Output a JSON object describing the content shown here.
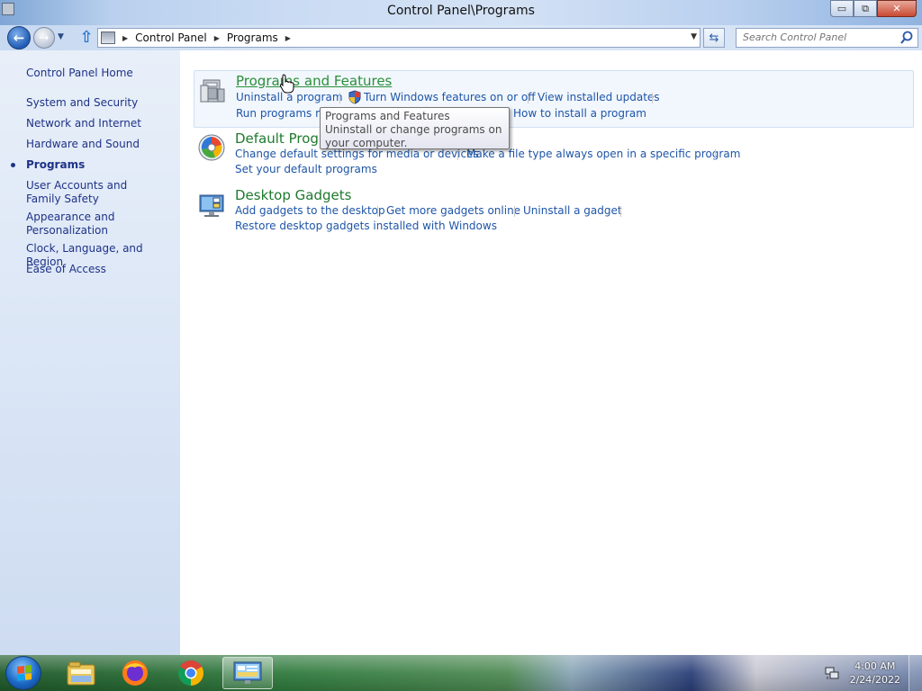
{
  "window": {
    "title": "Control Panel\\Programs",
    "buttons": {
      "minimize": "▭",
      "restore": "⧉",
      "close": "✕"
    }
  },
  "nav": {
    "back_icon": "back-arrow-icon",
    "forward_icon": "forward-arrow-icon",
    "breadcrumb": [
      "Control Panel",
      "Programs"
    ],
    "search_placeholder": "Search Control Panel"
  },
  "sidebar": {
    "items": [
      {
        "label": "Control Panel Home",
        "current": false
      },
      {
        "label": "System and Security",
        "current": false
      },
      {
        "label": "Network and Internet",
        "current": false
      },
      {
        "label": "Hardware and Sound",
        "current": false
      },
      {
        "label": "Programs",
        "current": true
      },
      {
        "label": "User Accounts and Family Safety",
        "current": false
      },
      {
        "label": "Appearance and Personalization",
        "current": false
      },
      {
        "label": "Clock, Language, and Region",
        "current": false
      },
      {
        "label": "Ease of Access",
        "current": false
      }
    ]
  },
  "categories": [
    {
      "title": "Programs and Features",
      "icon": "programs-features-icon",
      "hovered": true,
      "links": [
        "Uninstall a program",
        "Turn Windows features on or off",
        "View installed updates",
        "Run programs made for previous versions of Windows",
        "How to install a program"
      ]
    },
    {
      "title": "Default Programs",
      "icon": "default-programs-icon",
      "hovered": false,
      "links": [
        "Change default settings for media or devices",
        "Make a file type always open in a specific program",
        "Set your default programs"
      ]
    },
    {
      "title": "Desktop Gadgets",
      "icon": "desktop-gadgets-icon",
      "hovered": false,
      "links": [
        "Add gadgets to the desktop",
        "Get more gadgets online",
        "Uninstall a gadget",
        "Restore desktop gadgets installed with Windows"
      ]
    }
  ],
  "tooltip": {
    "title": "Programs and Features",
    "body": "Uninstall or change programs on your computer."
  },
  "taskbar": {
    "items": [
      "windows-explorer-icon",
      "firefox-icon",
      "chrome-icon",
      "control-panel-icon"
    ],
    "time": "4:00 AM",
    "date": "2/24/2022"
  },
  "colors": {
    "link": "#1e55a8",
    "category_title": "#1e7a2e",
    "sidebar_text": "#1e3287"
  }
}
